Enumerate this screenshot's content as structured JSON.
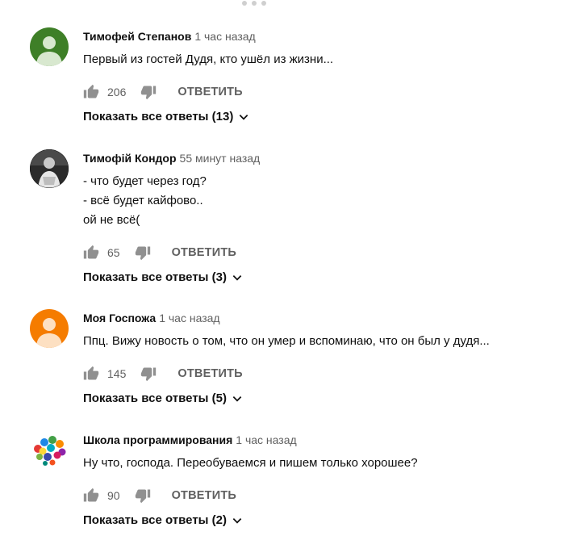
{
  "colors": {
    "secondary_text": "#606060",
    "primary_text": "#0f0f0f",
    "icon": "#909090"
  },
  "comments": [
    {
      "author": "Тимофей Степанов",
      "time": "1 час назад",
      "text": "Первый из гостей Дудя, кто ушёл из жизни...",
      "likes": "206",
      "reply_label": "ОТВЕТИТЬ",
      "show_replies": "Показать все ответы (13)",
      "avatar": {
        "type": "default",
        "background": "#3e7f27",
        "icon": "person-silhouette-icon"
      }
    },
    {
      "author": "Тимофій Кондор",
      "time": "55 минут назад",
      "text": "- что будет через год?\n- всё будет кайфово..\nой не всё(",
      "likes": "65",
      "reply_label": "ОТВЕТИТЬ",
      "show_replies": "Показать все ответы (3)",
      "avatar": {
        "type": "photo",
        "background": "#2b2b2b",
        "icon": "user-photo"
      }
    },
    {
      "author": "Моя Госпожа",
      "time": "1 час назад",
      "text": "Ппц. Вижу новость о том, что он умер и вспоминаю, что он был у дудя...",
      "likes": "145",
      "reply_label": "ОТВЕТИТЬ",
      "show_replies": "Показать все ответы (5)",
      "avatar": {
        "type": "default",
        "background": "#f57c00",
        "icon": "person-silhouette-icon"
      }
    },
    {
      "author": "Школа программирования",
      "time": "1 час назад",
      "text": "Ну что, господа. Переобуваемся и пишем только хорошее?",
      "likes": "90",
      "reply_label": "ОТВЕТИТЬ",
      "show_replies": "Показать все ответы (2)",
      "avatar": {
        "type": "logo",
        "background": "#ffffff",
        "icon": "colorful-icons-cloud-logo"
      }
    }
  ]
}
